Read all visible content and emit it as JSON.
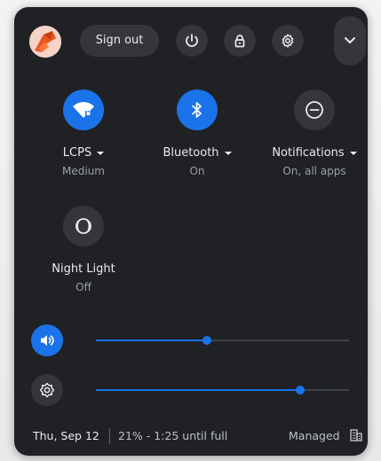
{
  "top_row": {
    "sign_out_label": "Sign out"
  },
  "tiles": [
    {
      "label": "LCPS",
      "sublabel": "Medium",
      "icon": "wifi-icon",
      "state": "on"
    },
    {
      "label": "Bluetooth",
      "sublabel": "On",
      "icon": "bluetooth-icon",
      "state": "on"
    },
    {
      "label": "Notifications",
      "sublabel": "On, all apps",
      "icon": "notifications-icon",
      "state": "off"
    },
    {
      "label": "Night Light",
      "sublabel": "Off",
      "icon": "night-light-icon",
      "state": "off"
    }
  ],
  "sliders": {
    "volume": {
      "icon": "volume-icon",
      "level": 0.44
    },
    "brightness": {
      "icon": "brightness-icon",
      "level": 0.807
    }
  },
  "footer": {
    "date": "Thu, Sep 12",
    "battery": "21% - 1:25 until full",
    "managed": "Managed"
  },
  "colors": {
    "panel_bg": "#202124",
    "button_bg": "#35363a",
    "accent": "#1a73e8",
    "text": "#e8eaed",
    "subtext": "#9aa0a6"
  }
}
